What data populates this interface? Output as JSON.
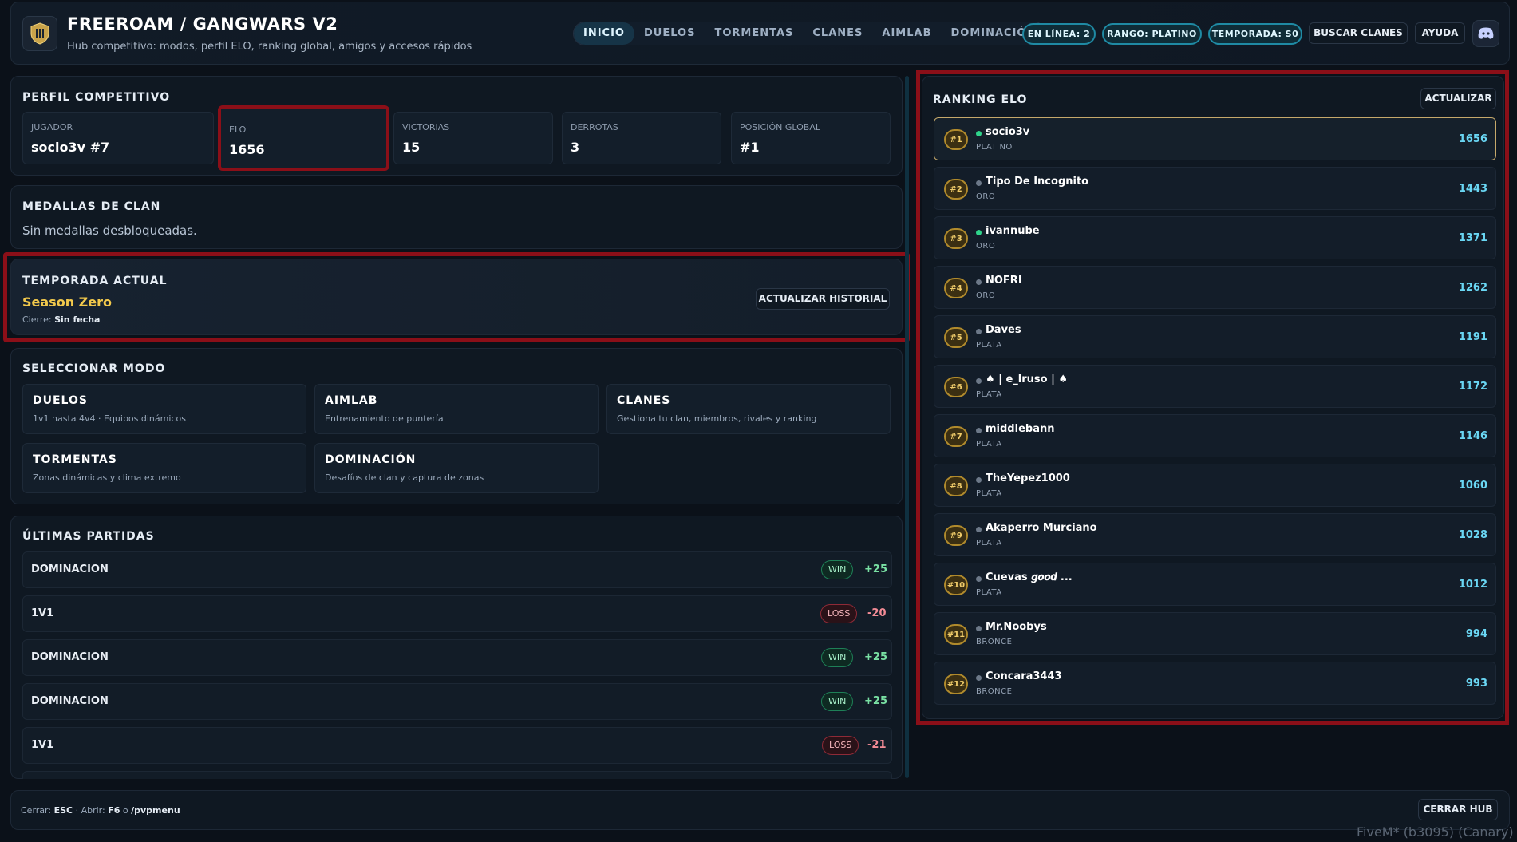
{
  "header": {
    "title": "FREEROAM / GANGWARS V2",
    "subtitle": "Hub competitivo: modos, perfil ELO, ranking global, amigos y accesos rápidos",
    "nav": [
      "INICIO",
      "DUELOS",
      "TORMENTAS",
      "CLANES",
      "AIMLAB",
      "DOMINACIÓN"
    ],
    "pills": {
      "online": "EN LÍNEA: 2",
      "rank": "RANGO: PLATINO",
      "season": "TEMPORADA: S0"
    },
    "buttons": {
      "search_clans": "BUSCAR CLANES",
      "help": "AYUDA"
    }
  },
  "profile": {
    "title": "PERFIL COMPETITIVO",
    "stats": [
      {
        "label": "JUGADOR",
        "value": "socio3v #7"
      },
      {
        "label": "ELO",
        "value": "1656"
      },
      {
        "label": "VICTORIAS",
        "value": "15"
      },
      {
        "label": "DERROTAS",
        "value": "3"
      },
      {
        "label": "POSICIÓN GLOBAL",
        "value": "#1"
      }
    ]
  },
  "medals": {
    "title": "MEDALLAS DE CLAN",
    "text": "Sin medallas desbloqueadas."
  },
  "season": {
    "title": "TEMPORADA ACTUAL",
    "name": "Season Zero",
    "close_label": "Cierre:",
    "close_value": "Sin fecha",
    "button": "ACTUALIZAR HISTORIAL"
  },
  "modes": {
    "title": "SELECCIONAR MODO",
    "items": [
      {
        "name": "DUELOS",
        "desc": "1v1 hasta 4v4 · Equipos dinámicos"
      },
      {
        "name": "AIMLAB",
        "desc": "Entrenamiento de puntería"
      },
      {
        "name": "CLANES",
        "desc": "Gestiona tu clan, miembros, rivales y ranking"
      },
      {
        "name": "TORMENTAS",
        "desc": "Zonas dinámicas y clima extremo"
      },
      {
        "name": "DOMINACIÓN",
        "desc": "Desafíos de clan y captura de zonas"
      }
    ]
  },
  "matches": {
    "title": "ÚLTIMAS PARTIDAS",
    "items": [
      {
        "mode": "DOMINACION",
        "result": "WIN",
        "delta": "+25"
      },
      {
        "mode": "1V1",
        "result": "LOSS",
        "delta": "-20"
      },
      {
        "mode": "DOMINACION",
        "result": "WIN",
        "delta": "+25"
      },
      {
        "mode": "DOMINACION",
        "result": "WIN",
        "delta": "+25"
      },
      {
        "mode": "1V1",
        "result": "LOSS",
        "delta": "-21"
      }
    ]
  },
  "ranking": {
    "title": "RANKING ELO",
    "button": "ACTUALIZAR",
    "players": [
      {
        "pos": "#1",
        "name": "socio3v",
        "tier": "PLATINO",
        "elo": "1656",
        "online": true
      },
      {
        "pos": "#2",
        "name": "Tipo De Incognito",
        "tier": "ORO",
        "elo": "1443",
        "online": false
      },
      {
        "pos": "#3",
        "name": "ivannube",
        "tier": "ORO",
        "elo": "1371",
        "online": true
      },
      {
        "pos": "#4",
        "name": "NOFRI",
        "tier": "ORO",
        "elo": "1262",
        "online": false
      },
      {
        "pos": "#5",
        "name": "Daves",
        "tier": "PLATA",
        "elo": "1191",
        "online": false
      },
      {
        "pos": "#6",
        "name": "♠ | e_lruso | ♠",
        "tier": "PLATA",
        "elo": "1172",
        "online": false
      },
      {
        "pos": "#7",
        "name": "middlebann",
        "tier": "PLATA",
        "elo": "1146",
        "online": false
      },
      {
        "pos": "#8",
        "name": "TheYepez1000",
        "tier": "PLATA",
        "elo": "1060",
        "online": false
      },
      {
        "pos": "#9",
        "name": "Akaperro Murciano",
        "tier": "PLATA",
        "elo": "1028",
        "online": false
      },
      {
        "pos": "#10",
        "name": "Cuevas 𝒈𝒐𝒐𝒅 ...",
        "tier": "PLATA",
        "elo": "1012",
        "online": false
      },
      {
        "pos": "#11",
        "name": "Mr.Noobys",
        "tier": "BRONCE",
        "elo": "994",
        "online": false
      },
      {
        "pos": "#12",
        "name": "Concara3443",
        "tier": "BRONCE",
        "elo": "993",
        "online": false
      }
    ]
  },
  "footer": {
    "close_label": "Cerrar:",
    "close_key": "ESC",
    "open_label": "· Abrir:",
    "open_key": "F6",
    "or": "o",
    "command": "/pvpmenu",
    "button": "CERRAR HUB"
  },
  "watermark": "FiveM* (b3095) (Canary)"
}
